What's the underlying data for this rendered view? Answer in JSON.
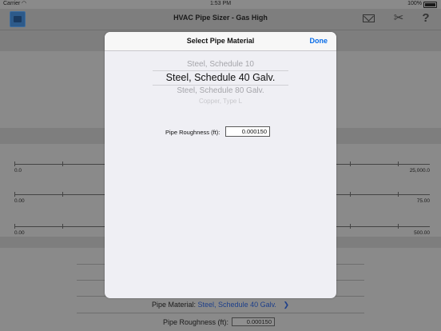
{
  "status_bar": {
    "carrier": "Carrier",
    "time": "1:53 PM",
    "battery": "100%"
  },
  "nav": {
    "title": "HVAC Pipe Sizer - Gas High",
    "icons": [
      "app-logo",
      "mail-icon",
      "tools-icon",
      "help-icon"
    ],
    "help_glyph": "?"
  },
  "sliders": [
    {
      "min": "0.0",
      "max": "25,000.0"
    },
    {
      "min": "0.00",
      "max": "75.00"
    },
    {
      "min": "0.00",
      "max": "500.00"
    }
  ],
  "bottom": {
    "pipe_material_label": "Pipe Material:",
    "pipe_material_value": "Steel, Schedule 40 Galv.",
    "pipe_roughness_label": "Pipe Roughness (ft):",
    "pipe_roughness_value": "0.000150"
  },
  "modal": {
    "title": "Select Pipe Material",
    "done_label": "Done",
    "options": [
      "Steel, Schedule 10",
      "Steel, Schedule 40 Galv.",
      "Steel, Schedule 80 Galv.",
      "Copper, Type L"
    ],
    "selected_index": 1,
    "roughness_label": "Pipe Roughness (ft):",
    "roughness_value": "0.000150"
  },
  "colors": {
    "accent": "#0a6de8",
    "overlay_bg": "#8a8a8a",
    "link_dimmed": "#1d3f8a"
  }
}
